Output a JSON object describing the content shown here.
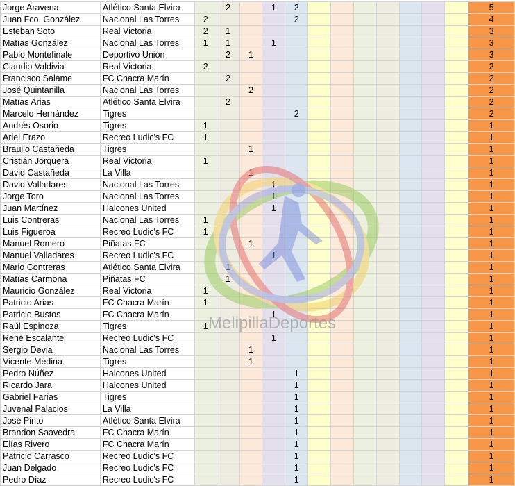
{
  "rows": [
    {
      "name": "Jorge Aravena",
      "team": "Atlético Santa Elvira",
      "cols": [
        "",
        "2",
        "",
        "1",
        "2"
      ],
      "total": "5"
    },
    {
      "name": "Juan Fco. González",
      "team": "Nacional Las Torres",
      "cols": [
        "2",
        "",
        "",
        "",
        "2"
      ],
      "total": "4"
    },
    {
      "name": "Esteban Soto",
      "team": "Real Victoria",
      "cols": [
        "2",
        "1",
        "",
        "",
        ""
      ],
      "total": "3"
    },
    {
      "name": "Matías González",
      "team": "Nacional Las Torres",
      "cols": [
        "1",
        "1",
        "",
        "1",
        ""
      ],
      "total": "3"
    },
    {
      "name": "Pablo Montefinale",
      "team": "Deportivo Unión",
      "cols": [
        "",
        "2",
        "1",
        "",
        ""
      ],
      "total": "3"
    },
    {
      "name": "Claudio Valdivia",
      "team": "Real Victoria",
      "cols": [
        "2",
        "",
        "",
        "",
        ""
      ],
      "total": "2"
    },
    {
      "name": "Francisco Salame",
      "team": "FC Chacra Marín",
      "cols": [
        "",
        "2",
        "",
        "",
        ""
      ],
      "total": "2"
    },
    {
      "name": "José Quintanilla",
      "team": "Nacional Las Torres",
      "cols": [
        "",
        "",
        "2",
        "",
        ""
      ],
      "total": "2"
    },
    {
      "name": "Matías Arias",
      "team": "Atlético Santa Elvira",
      "cols": [
        "",
        "2",
        "",
        "",
        ""
      ],
      "total": "2"
    },
    {
      "name": "Marcelo Hernández",
      "team": "Tigres",
      "cols": [
        "",
        "",
        "",
        "",
        "2"
      ],
      "total": "2"
    },
    {
      "name": "Andrés Osorio",
      "team": "Tigres",
      "cols": [
        "1",
        "",
        "",
        "",
        ""
      ],
      "total": "1"
    },
    {
      "name": "Ariel Erazo",
      "team": "Recreo Ludic's FC",
      "cols": [
        "1",
        "",
        "",
        "",
        ""
      ],
      "total": "1"
    },
    {
      "name": "Braulio Castañeda",
      "team": "Tigres",
      "cols": [
        "",
        "",
        "1",
        "",
        ""
      ],
      "total": "1"
    },
    {
      "name": "Cristián Jorquera",
      "team": "Real Victoria",
      "cols": [
        "1",
        "",
        "",
        "",
        ""
      ],
      "total": "1"
    },
    {
      "name": "David Castañeda",
      "team": "La Villa",
      "cols": [
        "",
        "",
        "1",
        "",
        ""
      ],
      "total": "1"
    },
    {
      "name": "David Valladares",
      "team": "Nacional Las Torres",
      "cols": [
        "",
        "",
        "",
        "1",
        ""
      ],
      "total": "1"
    },
    {
      "name": "Jorge Toro",
      "team": "Nacional Las Torres",
      "cols": [
        "",
        "",
        "",
        "1",
        ""
      ],
      "total": "1"
    },
    {
      "name": "Juan Martínez",
      "team": "Halcones United",
      "cols": [
        "",
        "",
        "",
        "1",
        ""
      ],
      "total": "1"
    },
    {
      "name": "Luis Contreras",
      "team": "Nacional Las Torres",
      "cols": [
        "1",
        "",
        "",
        "",
        ""
      ],
      "total": "1"
    },
    {
      "name": "Luis Figueroa",
      "team": "Recreo Ludic's FC",
      "cols": [
        "1",
        "",
        "",
        "",
        ""
      ],
      "total": "1"
    },
    {
      "name": "Manuel Romero",
      "team": "Piñatas FC",
      "cols": [
        "",
        "",
        "1",
        "",
        ""
      ],
      "total": "1"
    },
    {
      "name": "Manuel Valladares",
      "team": "Recreo Ludic's FC",
      "cols": [
        "",
        "",
        "",
        "1",
        ""
      ],
      "total": "1"
    },
    {
      "name": "Mario Contreras",
      "team": "Atlético Santa Elvira",
      "cols": [
        "",
        "1",
        "",
        "",
        ""
      ],
      "total": "1"
    },
    {
      "name": "Matías Carmona",
      "team": "Piñatas FC",
      "cols": [
        "",
        "1",
        "",
        "",
        ""
      ],
      "total": "1"
    },
    {
      "name": "Mauricio González",
      "team": "Real Victoria",
      "cols": [
        "1",
        "",
        "",
        "",
        ""
      ],
      "total": "1"
    },
    {
      "name": "Patricio Arias",
      "team": "FC Chacra Marín",
      "cols": [
        "1",
        "",
        "",
        "",
        ""
      ],
      "total": "1"
    },
    {
      "name": "Patricio Bustos",
      "team": "FC Chacra Marín",
      "cols": [
        "",
        "",
        "",
        "1",
        ""
      ],
      "total": "1"
    },
    {
      "name": "Raúl Espinoza",
      "team": "Tigres",
      "cols": [
        "1",
        "",
        "",
        "",
        ""
      ],
      "total": "1"
    },
    {
      "name": "René Escalante",
      "team": "Recreo Ludic's FC",
      "cols": [
        "",
        "",
        "",
        "1",
        ""
      ],
      "total": "1"
    },
    {
      "name": "Sergio Devia",
      "team": "Nacional Las Torres",
      "cols": [
        "",
        "",
        "1",
        "",
        ""
      ],
      "total": "1"
    },
    {
      "name": "Vicente Medina",
      "team": "Tigres",
      "cols": [
        "",
        "",
        "1",
        "",
        ""
      ],
      "total": "1"
    },
    {
      "name": "Pedro Núñez",
      "team": "Halcones United",
      "cols": [
        "",
        "",
        "",
        "",
        "1"
      ],
      "total": "1"
    },
    {
      "name": "Ricardo Jara",
      "team": "Halcones United",
      "cols": [
        "",
        "",
        "",
        "",
        "1"
      ],
      "total": "1"
    },
    {
      "name": "Gabriel Farías",
      "team": "Tigres",
      "cols": [
        "",
        "",
        "",
        "",
        "1"
      ],
      "total": "1"
    },
    {
      "name": "Juvenal Palacios",
      "team": "La Villa",
      "cols": [
        "",
        "",
        "",
        "",
        "1"
      ],
      "total": "1"
    },
    {
      "name": "José Pinto",
      "team": "Atlético Santa Elvira",
      "cols": [
        "",
        "",
        "",
        "",
        "1"
      ],
      "total": "1"
    },
    {
      "name": "Brandon Saavedra",
      "team": "FC Chacra Marín",
      "cols": [
        "",
        "",
        "",
        "",
        "1"
      ],
      "total": "1"
    },
    {
      "name": "Elías Rivero",
      "team": "FC Chacra Marín",
      "cols": [
        "",
        "",
        "",
        "",
        "1"
      ],
      "total": "1"
    },
    {
      "name": "Patricio Carrasco",
      "team": "Recreo Ludic's FC",
      "cols": [
        "",
        "",
        "",
        "",
        "1"
      ],
      "total": "1"
    },
    {
      "name": "Juan Delgado",
      "team": "Recreo Ludic's FC",
      "cols": [
        "",
        "",
        "",
        "",
        "1"
      ],
      "total": "1"
    },
    {
      "name": "Pedro Díaz",
      "team": "Recreo Ludic's FC",
      "cols": [
        "",
        "",
        "",
        "",
        "1"
      ],
      "total": "1"
    }
  ],
  "column_colors": [
    "#ebf1de",
    "#eeece1",
    "#fde9d9",
    "#e4dfec",
    "#dce6f1",
    "#ffffcc",
    "#fde9d9",
    "#ebf1de",
    "#eeece1",
    "#dce6f1",
    "#e4dfec",
    "#ffffcc"
  ],
  "total_color": "#f79646",
  "watermark": "MelipillaDeportes"
}
